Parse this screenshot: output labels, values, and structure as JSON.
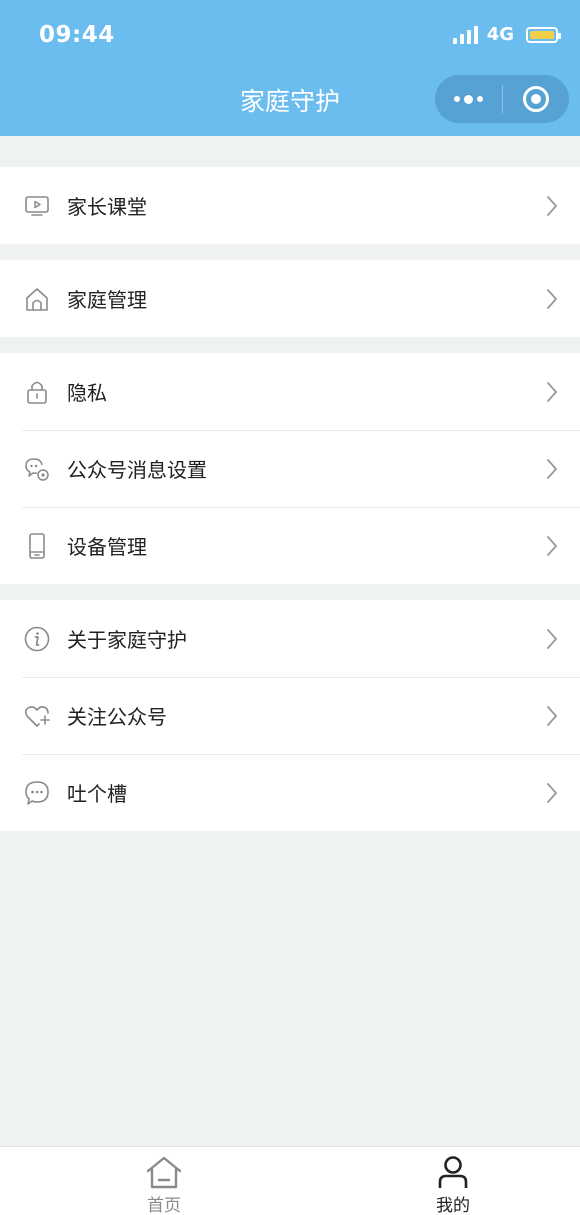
{
  "status_bar": {
    "time": "09:44",
    "network": "4G"
  },
  "header": {
    "title": "家庭守护"
  },
  "groups": [
    {
      "items": [
        {
          "label": "家长课堂",
          "icon": "video-screen-icon"
        }
      ]
    },
    {
      "items": [
        {
          "label": "家庭管理",
          "icon": "home-icon"
        }
      ]
    },
    {
      "items": [
        {
          "label": "隐私",
          "icon": "lock-icon"
        },
        {
          "label": "公众号消息设置",
          "icon": "chat-settings-icon"
        },
        {
          "label": "设备管理",
          "icon": "phone-device-icon"
        }
      ]
    },
    {
      "items": [
        {
          "label": "关于家庭守护",
          "icon": "info-icon"
        },
        {
          "label": "关注公众号",
          "icon": "heart-plus-icon"
        },
        {
          "label": "吐个槽",
          "icon": "chat-bubble-icon"
        }
      ]
    }
  ],
  "tabbar": {
    "tabs": [
      {
        "label": "首页",
        "icon": "home-tab-icon",
        "active": false
      },
      {
        "label": "我的",
        "icon": "profile-tab-icon",
        "active": true
      }
    ]
  },
  "colors": {
    "header_bg": "#6bbdf0",
    "page_bg": "#eff2f3",
    "battery": "#f3d04a",
    "tab_inactive": "#8a8a8a",
    "tab_active": "#222222"
  }
}
